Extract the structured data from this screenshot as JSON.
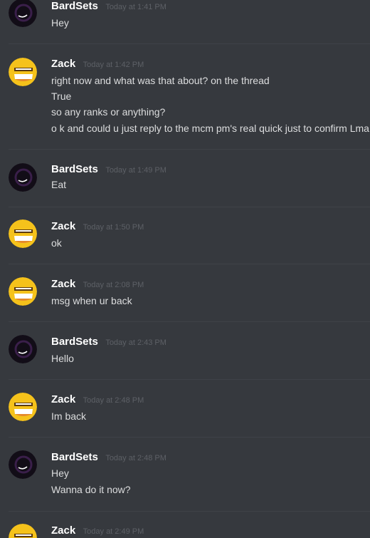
{
  "colors": {
    "background": "#36393e",
    "username": "#ffffff",
    "message_text": "#dcddde",
    "timestamp": "#5d6066",
    "divider": "#3f4248",
    "zack_avatar": "#f5c21b",
    "bardsets_avatar": "#120d17"
  },
  "messages": [
    {
      "author": "BardSets",
      "avatar": "dark-orb-avatar",
      "timestamp": "Today at 1:41 PM",
      "lines": [
        "Hey"
      ]
    },
    {
      "author": "Zack",
      "avatar": "yellow-smiley-avatar",
      "timestamp": "Today at 1:42 PM",
      "lines": [
        "right now and what was that about? on the thread",
        "True",
        "so any ranks or anything?",
        "o k and could u just reply to the mcm pm's real quick just to confirm Lma"
      ]
    },
    {
      "author": "BardSets",
      "avatar": "dark-orb-avatar",
      "timestamp": "Today at 1:49 PM",
      "lines": [
        "Eat"
      ]
    },
    {
      "author": "Zack",
      "avatar": "yellow-smiley-avatar",
      "timestamp": "Today at 1:50 PM",
      "lines": [
        "ok"
      ]
    },
    {
      "author": "Zack",
      "avatar": "yellow-smiley-avatar",
      "timestamp": "Today at 2:08 PM",
      "lines": [
        "msg when ur back"
      ]
    },
    {
      "author": "BardSets",
      "avatar": "dark-orb-avatar",
      "timestamp": "Today at 2:43 PM",
      "lines": [
        "Hello"
      ]
    },
    {
      "author": "Zack",
      "avatar": "yellow-smiley-avatar",
      "timestamp": "Today at 2:48 PM",
      "lines": [
        "Im back"
      ]
    },
    {
      "author": "BardSets",
      "avatar": "dark-orb-avatar",
      "timestamp": "Today at 2:48 PM",
      "lines": [
        "Hey",
        "Wanna do it now?"
      ]
    },
    {
      "author": "Zack",
      "avatar": "yellow-smiley-avatar",
      "timestamp": "Today at 2:49 PM",
      "lines": []
    }
  ]
}
